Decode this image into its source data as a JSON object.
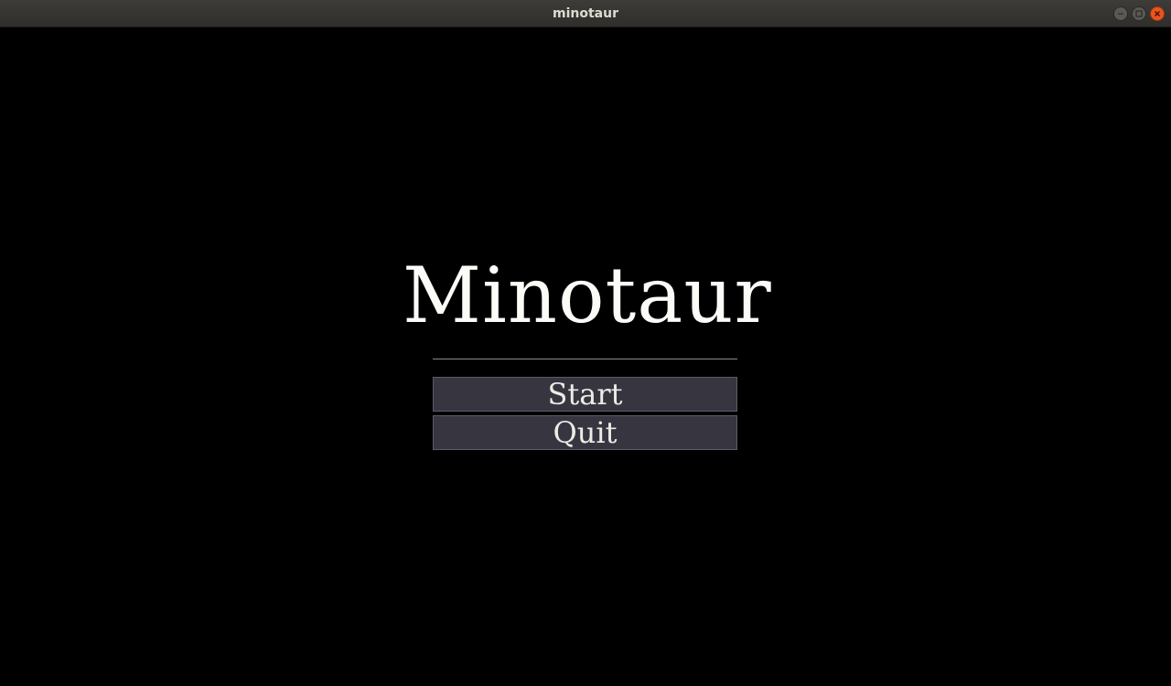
{
  "window": {
    "title": "minotaur",
    "controls": {
      "minimize_icon": "minimize-icon",
      "maximize_icon": "maximize-icon",
      "close_icon": "close-icon"
    }
  },
  "menu": {
    "game_title": "Minotaur",
    "start_label": "Start",
    "quit_label": "Quit"
  },
  "colors": {
    "background": "#000000",
    "button_fill": "#373640",
    "close_button": "#e95420"
  }
}
